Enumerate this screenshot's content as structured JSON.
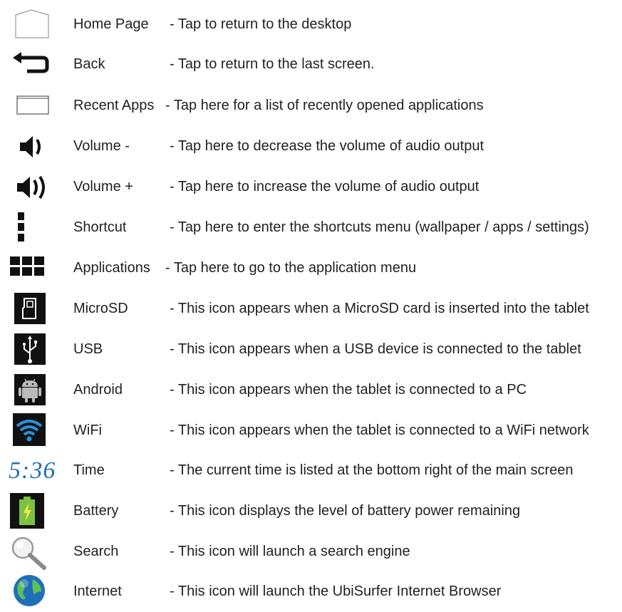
{
  "rows": [
    {
      "name": "Home Page",
      "desc": "- Tap to return to the desktop",
      "icon": "home-icon"
    },
    {
      "name": "Back",
      "desc": "- Tap to return to the last screen.",
      "icon": "back-arrow-icon"
    },
    {
      "name": "Recent Apps",
      "desc": "- Tap here for a list of recently opened applications",
      "icon": "recent-apps-icon"
    },
    {
      "name": "Volume -",
      "desc": "- Tap here to decrease the volume of audio output",
      "icon": "volume-down-icon"
    },
    {
      "name": "Volume +",
      "desc": "- Tap here to increase the volume of audio output",
      "icon": "volume-up-icon"
    },
    {
      "name": "Shortcut",
      "desc": "- Tap here to enter the shortcuts menu (wallpaper / apps / settings)",
      "icon": "vertical-dots-icon"
    },
    {
      "name": "Applications",
      "desc": "- Tap here to go to the application menu",
      "icon": "app-grid-icon"
    },
    {
      "name": "MicroSD",
      "desc": "- This icon appears when a MicroSD card is inserted into the tablet",
      "icon": "microsd-icon"
    },
    {
      "name": "USB",
      "desc": "- This icon appears when a USB device is connected to the tablet",
      "icon": "usb-icon"
    },
    {
      "name": "Android",
      "desc": "- This icon appears when the tablet is connected to a PC",
      "icon": "android-icon"
    },
    {
      "name": "WiFi",
      "desc": "- This icon appears when the tablet is connected to a WiFi network",
      "icon": "wifi-icon"
    },
    {
      "name": "Time",
      "desc": "- The current time is listed at the bottom right of the main screen",
      "icon": "clock-text-icon"
    },
    {
      "name": "Battery",
      "desc": "- This icon displays the level of battery power remaining",
      "icon": "battery-icon"
    },
    {
      "name": "Search",
      "desc": "- This icon will launch a search engine",
      "icon": "magnifier-icon"
    },
    {
      "name": "Internet",
      "desc": "- This icon will launch the UbiSurfer Internet Browser",
      "icon": "globe-icon"
    }
  ],
  "time_icon_text": "5:36",
  "colors": {
    "text": "#231f20",
    "time_blue": "#1e6fb5",
    "icon_dark": "#111111",
    "battery_green": "#7cc142"
  }
}
